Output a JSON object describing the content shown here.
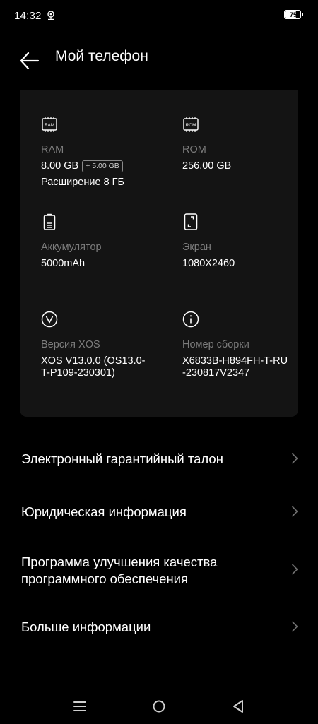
{
  "status_bar": {
    "time": "14:32",
    "battery_level": "75",
    "battery_fraction": 0.75,
    "icons": [
      "location-icon",
      "battery-icon"
    ]
  },
  "header": {
    "title": "Мой телефон",
    "back_icon": "arrow-left-icon"
  },
  "specs": {
    "ram": {
      "icon": "ram-chip-icon",
      "icon_text": "RAM",
      "label": "RAM",
      "value": "8.00 GB",
      "extra": "+ 5.00 GB",
      "sub": "Расширение 8 ГБ"
    },
    "rom": {
      "icon": "rom-chip-icon",
      "icon_text": "ROM",
      "label": "ROM",
      "value": "256.00 GB"
    },
    "battery": {
      "icon": "battery-icon",
      "label": "Аккумулятор",
      "value": "5000mAh"
    },
    "screen": {
      "icon": "phone-screen-icon",
      "label": "Экран",
      "value": "1080X2460"
    },
    "xos": {
      "icon": "xos-logo-icon",
      "label": "Версия XOS",
      "value_line1": "XOS V13.0.0 (OS13.0-",
      "value_line2": "T-P109-230301)"
    },
    "build": {
      "icon": "info-icon",
      "label": "Номер сборки",
      "value_line1": "X6833B-H894FH-T-RU",
      "value_line2": "-230817V2347"
    }
  },
  "menu": [
    {
      "line1": "Электронный гарантийный талон",
      "line2": ""
    },
    {
      "line1": "Юридическая информация",
      "line2": ""
    },
    {
      "line1": "Программа улучшения качества",
      "line2": "программного обеспечения"
    },
    {
      "line1": "Больше информации",
      "line2": ""
    }
  ],
  "nav": {
    "icons": [
      "menu-icon",
      "home-icon",
      "back-triangle-icon"
    ]
  },
  "colors": {
    "background": "#000000",
    "card": "#141414",
    "label": "#7c7c7c",
    "text": "#ffffff",
    "chevron": "#6e6e6e"
  }
}
